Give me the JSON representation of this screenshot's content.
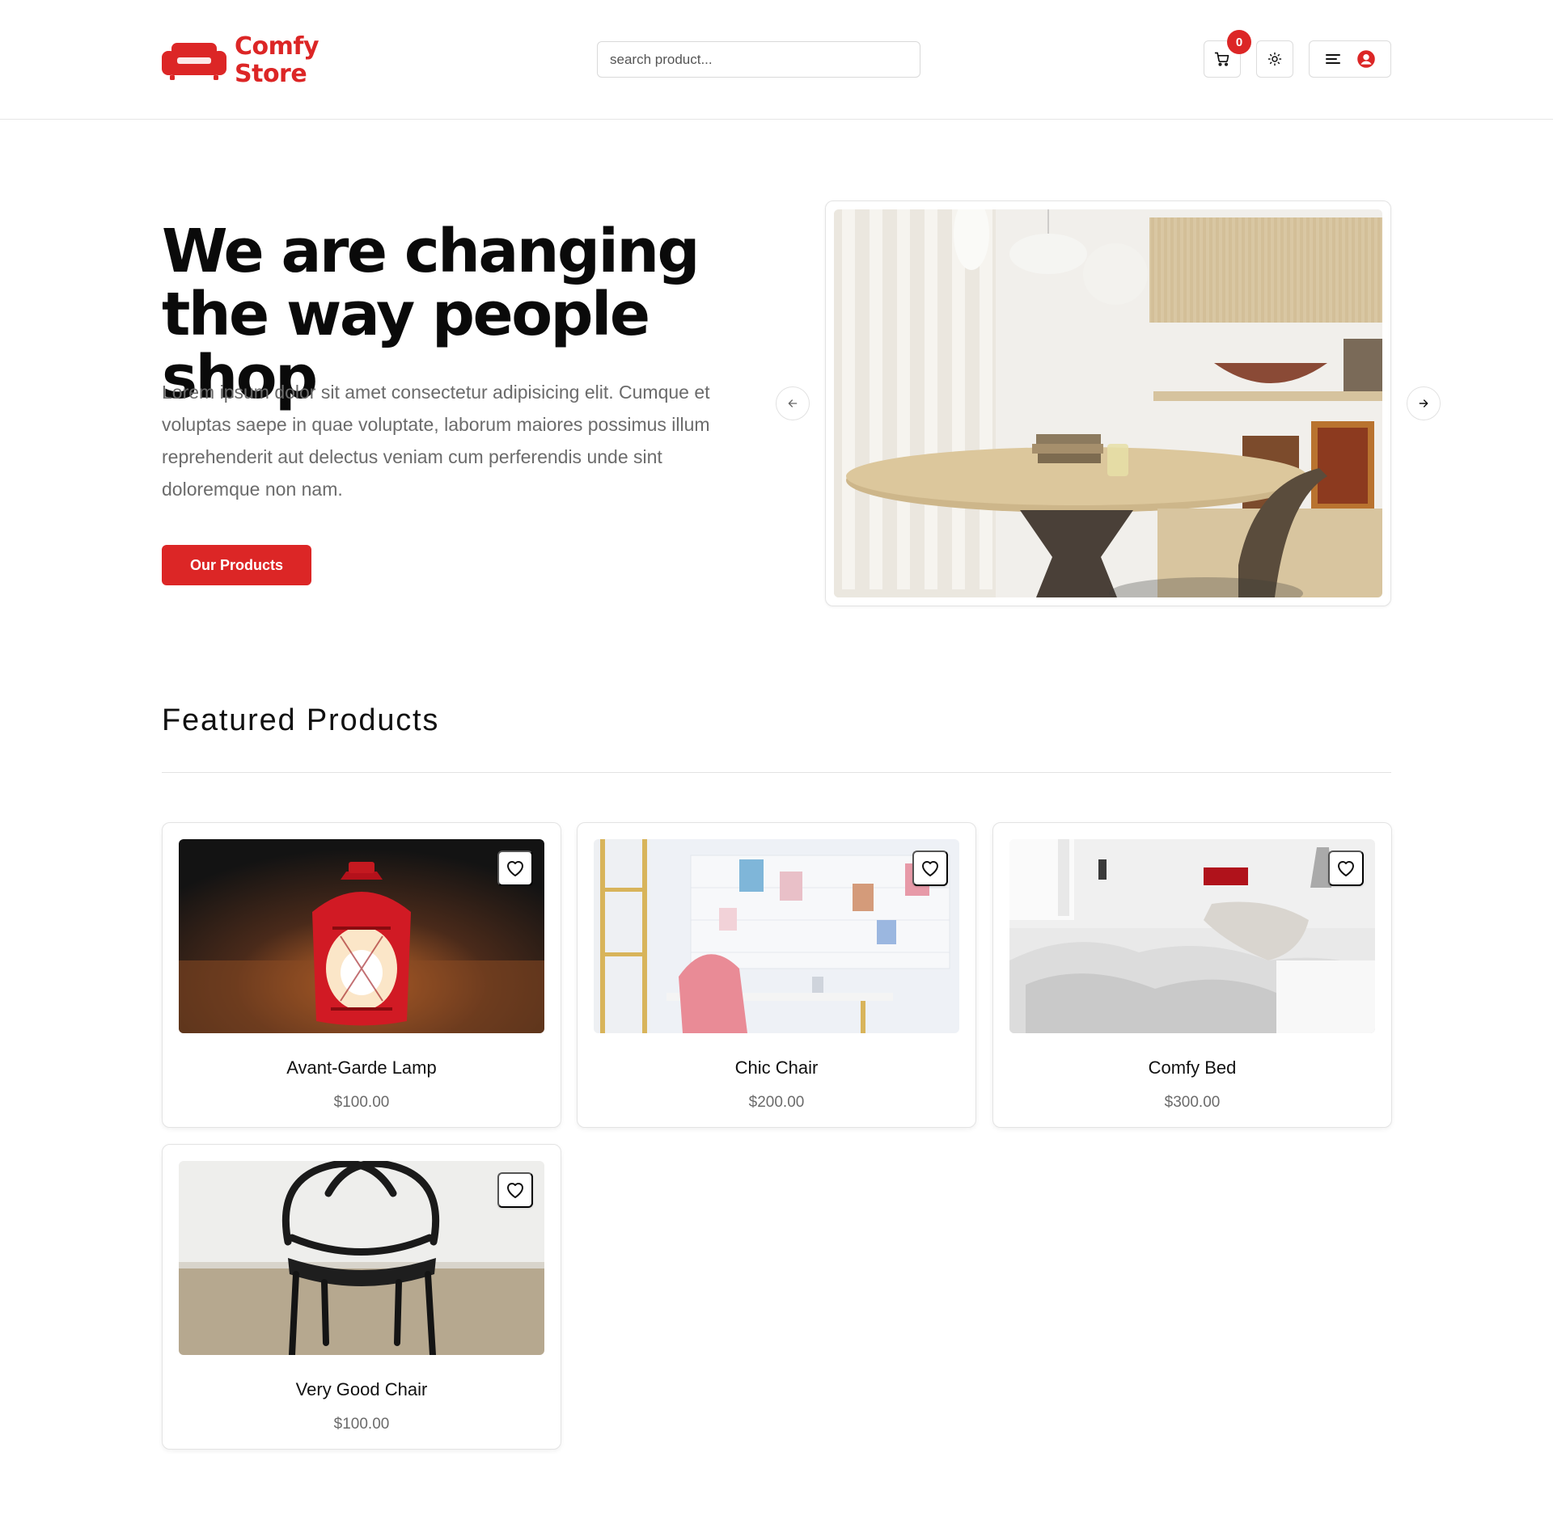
{
  "brand": {
    "line1": "Comfy",
    "line2": "Store",
    "color": "#dc2626",
    "icon": "sofa-icon"
  },
  "search": {
    "placeholder": "search product...",
    "value": ""
  },
  "header": {
    "cart_count": "0",
    "cart_icon": "cart-icon",
    "theme_icon": "sun-icon",
    "menu_icon": "menu-icon",
    "user_icon": "user-icon"
  },
  "hero": {
    "title": "We are changing the way people shop",
    "description": "Lorem ipsum dolor sit amet consectetur adipisicing elit. Cumque et voluptas saepe in quae voluptate, laborum maiores possimus illum reprehenderit aut delectus veniam cum perferendis unde sint doloremque non nam.",
    "cta_label": "Our Products",
    "carousel": {
      "prev_icon": "arrow-left-icon",
      "next_icon": "arrow-right-icon"
    }
  },
  "featured": {
    "title": "Featured Products",
    "products": [
      {
        "name": "Avant-Garde Lamp",
        "price": "$100.00"
      },
      {
        "name": "Chic Chair",
        "price": "$200.00"
      },
      {
        "name": "Comfy Bed",
        "price": "$300.00"
      },
      {
        "name": "Very Good Chair",
        "price": "$100.00"
      }
    ]
  },
  "colors": {
    "accent": "#dc2626",
    "muted_text": "#6b6b6b",
    "border": "#e3e3e3"
  }
}
